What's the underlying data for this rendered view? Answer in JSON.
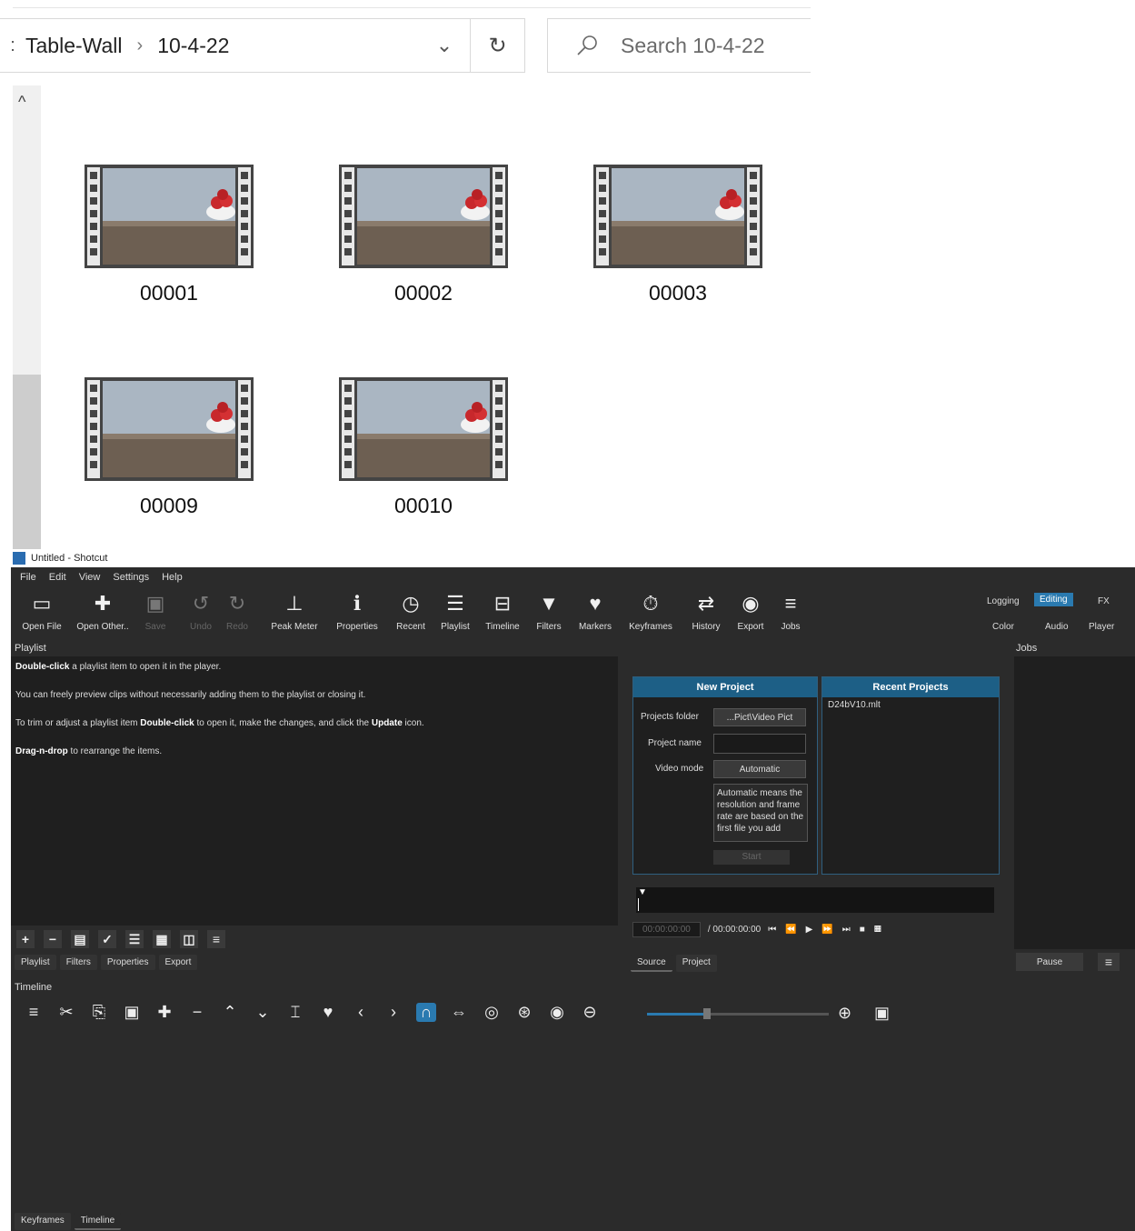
{
  "explorer": {
    "breadcrumb": [
      "Table-Wall",
      "10-4-22"
    ],
    "search_placeholder": "Search 10-4-22",
    "files": [
      "00001",
      "00002",
      "00003",
      "00009",
      "00010"
    ]
  },
  "shotcut": {
    "window_title": "Untitled - Shotcut",
    "menu": [
      "File",
      "Edit",
      "View",
      "Settings",
      "Help"
    ],
    "toolbar": [
      "Open File",
      "Open Other..",
      "Save",
      "Undo",
      "Redo",
      "Peak Meter",
      "Properties",
      "Recent",
      "Playlist",
      "Timeline",
      "Filters",
      "Markers",
      "Keyframes",
      "History",
      "Export",
      "Jobs"
    ],
    "layouts": [
      "Logging",
      "Editing",
      "FX",
      "Color",
      "Audio",
      "Player"
    ],
    "active_layout": "Editing",
    "playlist": {
      "title": "Playlist",
      "tips": [
        {
          "b1": "Double-click",
          "t1": " a playlist item to open it in the player.",
          "b2": "",
          "t2": "",
          "b3": "",
          "t3": ""
        },
        {
          "b1": "",
          "t1": "You can freely preview clips without necessarily adding them to the playlist or closing it.",
          "b2": "",
          "t2": "",
          "b3": "",
          "t3": ""
        },
        {
          "b1": "",
          "t1": "To trim or adjust a playlist item ",
          "b2": "Double-click",
          "t2": " to open it, make the changes, and click the ",
          "b3": "Update",
          "t3": " icon."
        },
        {
          "b1": "Drag-n-drop",
          "t1": " to rearrange the items.",
          "b2": "",
          "t2": "",
          "b3": "",
          "t3": ""
        }
      ],
      "tabs": [
        "Playlist",
        "Filters",
        "Properties",
        "Export"
      ]
    },
    "new_project": {
      "title": "New Project",
      "projects_folder_label": "Projects folder",
      "projects_folder_value": "...Pict\\Video Pict",
      "project_name_label": "Project name",
      "video_mode_label": "Video mode",
      "video_mode_value": "Automatic",
      "description": "Automatic means the resolution and frame rate are based on the first file you add",
      "start": "Start"
    },
    "recent_projects": {
      "title": "Recent Projects",
      "items": [
        "D24bV10.mlt"
      ]
    },
    "player": {
      "timecode": "00:00:00:00",
      "duration": "/ 00:00:00:00",
      "tabs": [
        "Source",
        "Project"
      ]
    },
    "jobs": {
      "title": "Jobs",
      "pause": "Pause"
    },
    "timeline": {
      "title": "Timeline",
      "tabs": [
        "Keyframes",
        "Timeline"
      ]
    }
  }
}
